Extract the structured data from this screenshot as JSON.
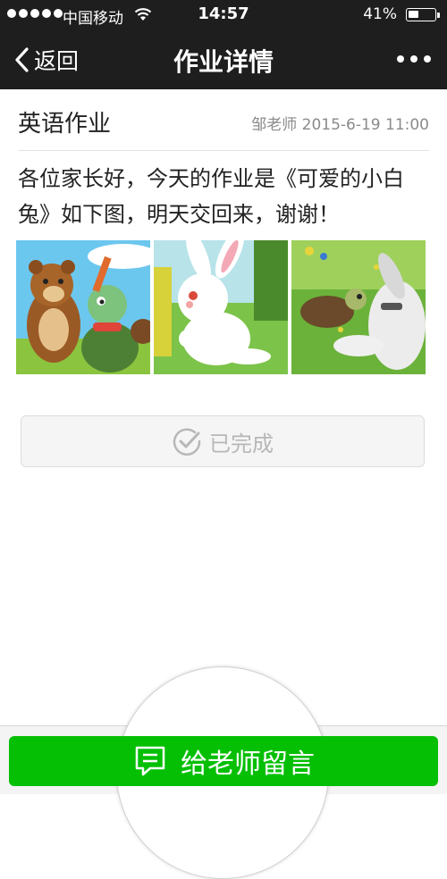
{
  "status": {
    "carrier": "中国移动",
    "time": "14:57",
    "battery": "41%",
    "battery_level": 0.41
  },
  "nav": {
    "back_label": "返回",
    "title": "作业详情"
  },
  "homework": {
    "title": "英语作业",
    "meta": "邹老师 2015-6-19 11:00",
    "description": "各位家长好，今天的作业是《可爱的小白兔》如下图，明天交回来，谢谢！",
    "images": [
      "bear-and-turtle-picture",
      "white-rabbit-picture",
      "turtle-and-rabbit-picture"
    ]
  },
  "done_button": {
    "label": "已完成"
  },
  "message_button": {
    "label": "给老师留言"
  },
  "colors": {
    "nav_bg": "#1e1e1e",
    "accent_green": "#05bf05"
  }
}
